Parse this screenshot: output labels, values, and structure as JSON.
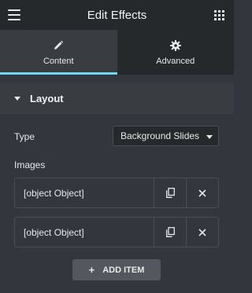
{
  "header": {
    "title": "Edit Effects",
    "menu_icon": "hamburger-icon",
    "apps_icon": "grid-icon"
  },
  "tabs": [
    {
      "label": "Content",
      "icon": "pencil-icon",
      "active": true
    },
    {
      "label": "Advanced",
      "icon": "gear-icon",
      "active": false
    }
  ],
  "section": {
    "label": "Layout",
    "expanded": true
  },
  "controls": {
    "type_label": "Type",
    "type_value": "Background Slides",
    "images_label": "Images"
  },
  "items": [
    {
      "title": "[object Object]"
    },
    {
      "title": "[object Object]"
    }
  ],
  "add_button": {
    "label": "ADD ITEM"
  },
  "colors": {
    "accent": "#71d7f7",
    "header_bg": "#26292c",
    "panel_bg": "#33373d"
  }
}
